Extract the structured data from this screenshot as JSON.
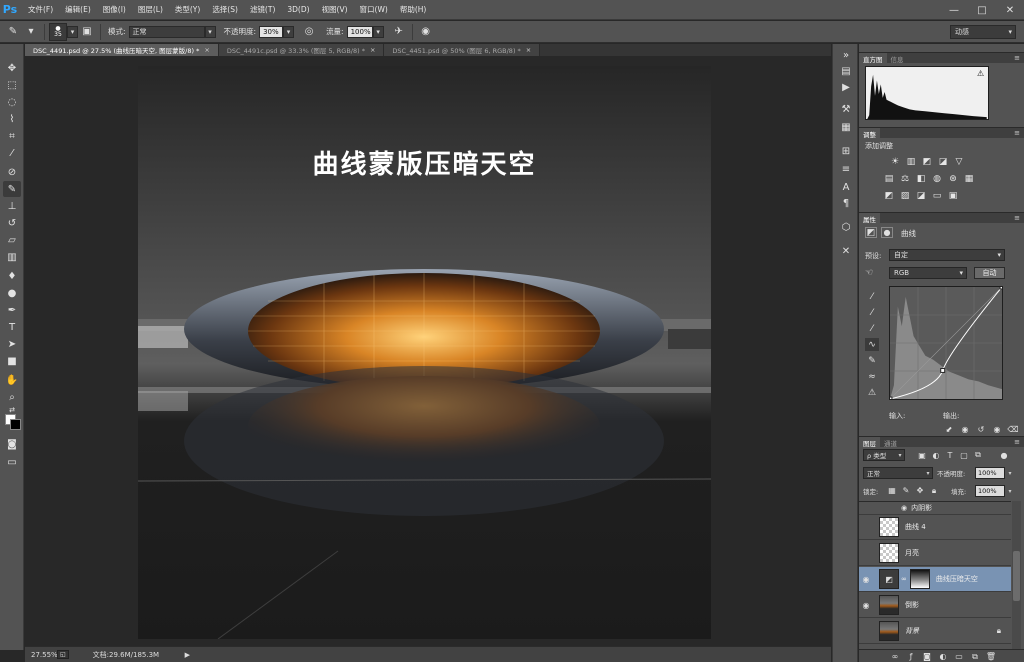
{
  "app": {
    "logo": "Ps"
  },
  "menu": [
    "文件(F)",
    "编辑(E)",
    "图像(I)",
    "图层(L)",
    "类型(Y)",
    "选择(S)",
    "滤镜(T)",
    "3D(D)",
    "视图(V)",
    "窗口(W)",
    "帮助(H)"
  ],
  "window_controls": {
    "minimize": "—",
    "maximize": "□",
    "close": "✕"
  },
  "options_bar": {
    "brush_size": "35",
    "mode_label": "模式:",
    "mode_value": "正常",
    "opacity_label": "不透明度:",
    "opacity_value": "30%",
    "flow_label": "流量:",
    "flow_value": "100%",
    "workspace": "动感"
  },
  "tabs": [
    {
      "title": "DSC_4491.psd @ 27.5% (曲线压暗天空, 图层蒙版/8) *",
      "close": "×",
      "active": true
    },
    {
      "title": "DSC_4491c.psd @ 33.3% (图层 5, RGB/8) *",
      "close": "×",
      "active": false
    },
    {
      "title": "DSC_4451.psd @ 50% (图层 6, RGB/8) *",
      "close": "×",
      "active": false
    }
  ],
  "document": {
    "title": "曲线蒙版压暗天空"
  },
  "status": {
    "zoom": "27.55%",
    "doc_size": "文档:29.6M/185.3M",
    "arrow": "▶"
  },
  "panels": {
    "histogram": {
      "tabs": [
        "直方图",
        "信息"
      ],
      "warning": "⚠"
    },
    "adjustments": {
      "tab": "调整",
      "title": "添加调整"
    },
    "properties": {
      "tab": "属性",
      "name": "曲线",
      "preset_label": "预设:",
      "preset_value": "自定",
      "channel_value": "RGB",
      "auto_label": "自动",
      "input_label": "输入:",
      "output_label": "输出:"
    },
    "layers": {
      "tabs": [
        "图层",
        "通道"
      ],
      "filter_kind": "ρ 类型",
      "blend_mode": "正常",
      "opacity_label": "不透明度:",
      "opacity_value": "100%",
      "lock_label": "锁定:",
      "fill_label": "填充:",
      "fill_value": "100%",
      "effect_name": "内阴影",
      "items": [
        {
          "name": "曲线 4",
          "visible": false
        },
        {
          "name": "月亮",
          "visible": false
        },
        {
          "name": "曲线压暗天空",
          "visible": true
        },
        {
          "name": "倒影",
          "visible": true
        },
        {
          "name": "背景",
          "visible": false
        }
      ]
    }
  },
  "colors": {
    "selected_layer": "#7993b3",
    "accent": "#31a8ff",
    "panel": "#535353"
  },
  "curve": {
    "points": [
      [
        0,
        0
      ],
      [
        120,
        65
      ],
      [
        255,
        255
      ]
    ]
  }
}
